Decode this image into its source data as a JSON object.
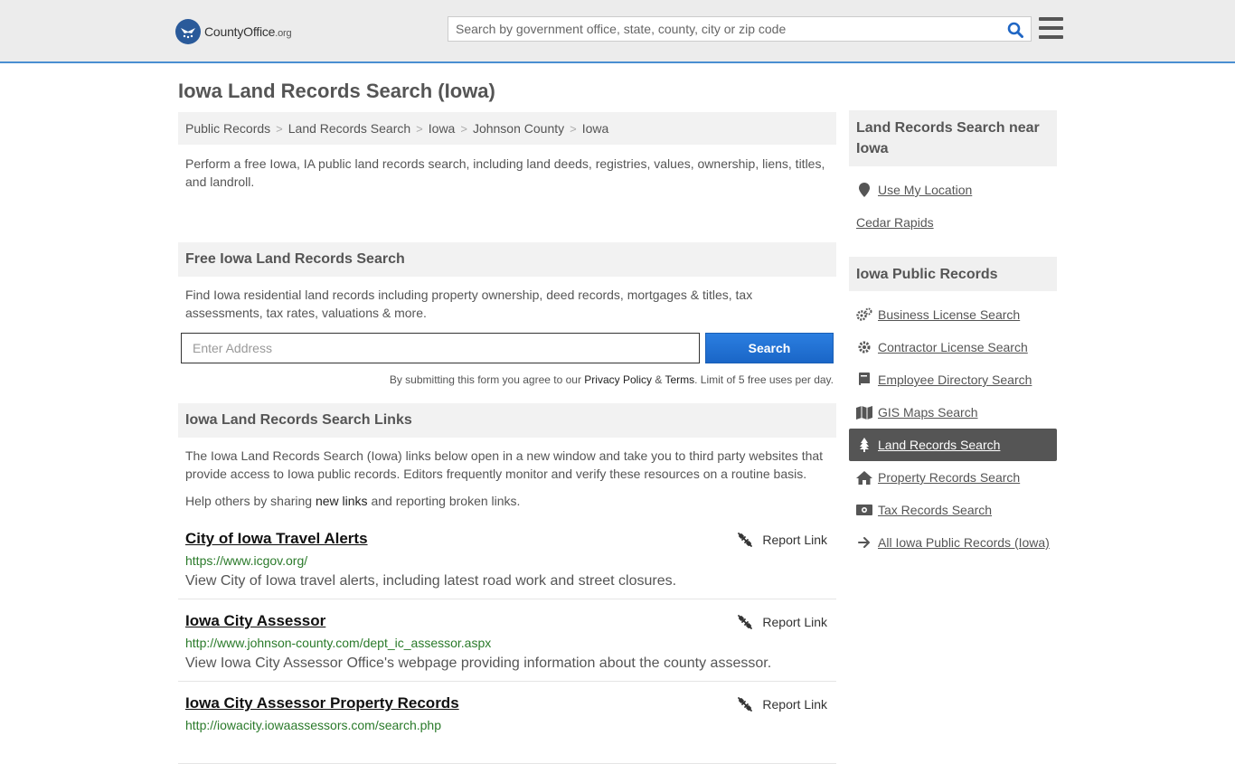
{
  "header": {
    "logo_name": "CountyOffice",
    "logo_domain": ".org",
    "search_placeholder": "Search by government office, state, county, city or zip code"
  },
  "page_title": "Iowa Land Records Search (Iowa)",
  "breadcrumb": [
    "Public Records",
    "Land Records Search",
    "Iowa",
    "Johnson County",
    "Iowa"
  ],
  "intro": "Perform a free Iowa, IA public land records search, including land deeds, registries, values, ownership, liens, titles, and landroll.",
  "free_search": {
    "heading": "Free Iowa Land Records Search",
    "text": "Find Iowa residential land records including property ownership, deed records, mortgages & titles, tax assessments, tax rates, valuations & more.",
    "input_placeholder": "Enter Address",
    "button_label": "Search",
    "disclaimer_pre": "By submitting this form you agree to our",
    "privacy_label": "Privacy Policy",
    "amp": "&",
    "terms_label": "Terms",
    "disclaimer_post": ". Limit of 5 free uses per day."
  },
  "links_section": {
    "heading": "Iowa Land Records Search Links",
    "intro": "The Iowa Land Records Search (Iowa) links below open in a new window and take you to third party websites that provide access to Iowa public records. Editors frequently monitor and verify these resources on a routine basis.",
    "share_pre": "Help others by sharing",
    "share_link": "new links",
    "share_post": "and reporting broken links.",
    "report_label": "Report Link",
    "items": [
      {
        "title": "City of Iowa Travel Alerts",
        "url": "https://www.icgov.org/",
        "desc": "View City of Iowa travel alerts, including latest road work and street closures."
      },
      {
        "title": "Iowa City Assessor",
        "url": "http://www.johnson-county.com/dept_ic_assessor.aspx",
        "desc": "View Iowa City Assessor Office's webpage providing information about the county assessor."
      },
      {
        "title": "Iowa City Assessor Property Records",
        "url": "http://iowacity.iowaassessors.com/search.php",
        "desc": ""
      }
    ]
  },
  "sidebar": {
    "near_heading": "Land Records Search near Iowa",
    "use_location": "Use My Location",
    "nearby": "Cedar Rapids",
    "public_heading": "Iowa Public Records",
    "items": [
      {
        "label": "Business License Search",
        "icon": "gears-icon"
      },
      {
        "label": "Contractor License Search",
        "icon": "gear-icon"
      },
      {
        "label": "Employee Directory Search",
        "icon": "book-icon"
      },
      {
        "label": "GIS Maps Search",
        "icon": "map-icon"
      },
      {
        "label": "Land Records Search",
        "icon": "tree-icon"
      },
      {
        "label": "Property Records Search",
        "icon": "home-icon"
      },
      {
        "label": "Tax Records Search",
        "icon": "money-icon"
      },
      {
        "label": "All Iowa Public Records (Iowa)",
        "icon": "arrow-right-icon"
      }
    ],
    "active_item": "Land Records Search"
  },
  "colors": {
    "accent": "#1f73d6",
    "header_bg": "#ececec",
    "url_green": "#2a7a2a",
    "active_bg": "#555555"
  }
}
